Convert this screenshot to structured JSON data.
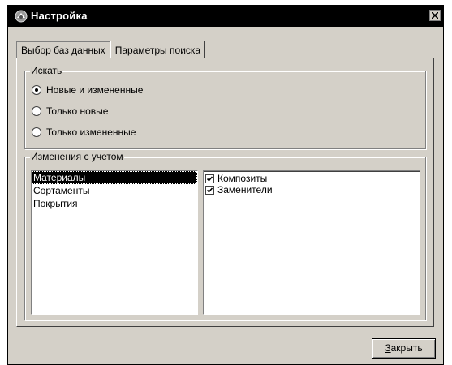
{
  "window": {
    "title": "Настройка",
    "close_glyph": "close-icon"
  },
  "tabs": [
    {
      "label": "Выбор баз данных",
      "active": false
    },
    {
      "label": "Параметры поиска",
      "active": true
    }
  ],
  "search_group": {
    "legend": "Искать",
    "options": [
      {
        "label": "Новые и измененные",
        "selected": true
      },
      {
        "label": "Только новые",
        "selected": false
      },
      {
        "label": "Только измененные",
        "selected": false
      }
    ]
  },
  "changes_group": {
    "legend": "Изменения с учетом",
    "categories": [
      {
        "label": "Материалы",
        "selected": true
      },
      {
        "label": "Сортаменты",
        "selected": false
      },
      {
        "label": "Покрытия",
        "selected": false
      }
    ],
    "options": [
      {
        "label": "Композиты",
        "checked": true
      },
      {
        "label": "Заменители",
        "checked": true
      }
    ]
  },
  "footer": {
    "close_button_mnemonic": "З",
    "close_button_rest": "акрыть"
  },
  "colors": {
    "dialog_bg": "#d4d0c8",
    "titlebar_bg": "#000000",
    "selection_bg": "#000000"
  }
}
